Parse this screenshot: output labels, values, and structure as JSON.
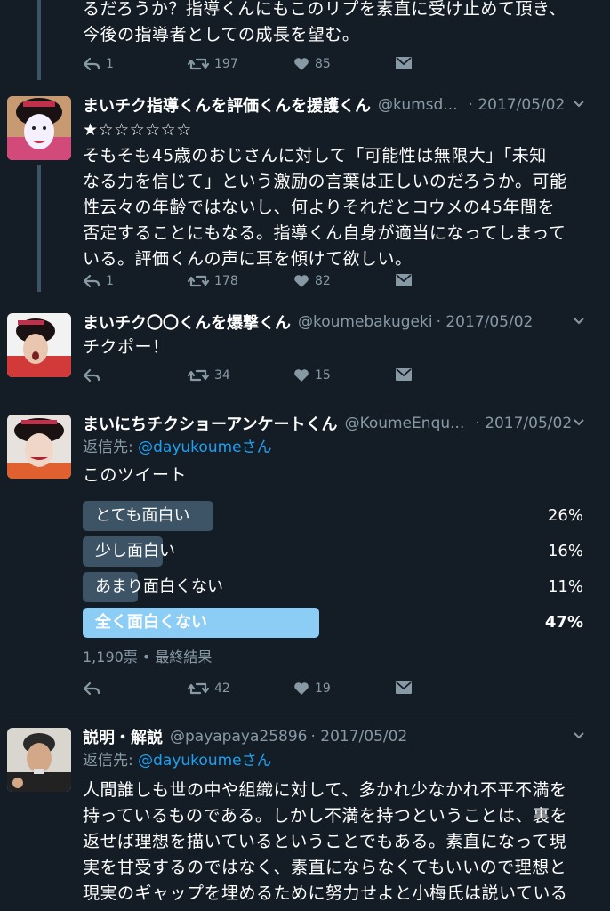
{
  "tweets": [
    {
      "text_lines": [
        "るだろうか？指導くんにもこのリプを素直に受け止めて頂き、",
        "今後の指導者としての成長を望む。"
      ],
      "replies": "1",
      "retweets": "197",
      "likes": "85"
    },
    {
      "name": "まいチク指導くんを評価くんを援護くん",
      "handle": "@kumsd...",
      "date": "· 2017/05/02",
      "stars": "★☆☆☆☆☆☆",
      "text_lines": [
        "そもそも45歳のおじさんに対して「可能性は無限大」「未知",
        "なる力を信じて」という激励の言葉は正しいのだろうか。可能",
        "性云々の年齢ではないし、何よりそれだとコウメの45年間を",
        "否定することにもなる。指導くん自身が適当になってしまって",
        "いる。評価くんの声に耳を傾けて欲しい。"
      ],
      "replies": "1",
      "retweets": "178",
      "likes": "82"
    },
    {
      "name": "まいチク〇〇くんを爆撃くん",
      "handle": "@koumebakugeki",
      "date": "· 2017/05/02",
      "text_lines": [
        "チクポー！"
      ],
      "replies": "",
      "retweets": "34",
      "likes": "15"
    },
    {
      "name": "まいにちチクショーアンケートくん",
      "handle": "@KoumeEnqu...",
      "date": "· 2017/05/02",
      "reply_prefix": "返信先: ",
      "reply_target": "@dayukoumeさん",
      "text_lines": [
        "このツイート"
      ],
      "poll": {
        "options": [
          {
            "label": "とても面白い",
            "percent": "26%",
            "value": 26
          },
          {
            "label": "少し面白い",
            "percent": "16%",
            "value": 16
          },
          {
            "label": "あまり面白くない",
            "percent": "11%",
            "value": 11
          },
          {
            "label": "全く面白くない",
            "percent": "47%",
            "value": 47
          }
        ],
        "meta": "1,190票 • 最終結果"
      },
      "replies": "",
      "retweets": "42",
      "likes": "19"
    },
    {
      "name": "説明・解説",
      "handle": "@payapaya25896",
      "date": "· 2017/05/02",
      "reply_prefix": "返信先: ",
      "reply_target": "@dayukoumeさん",
      "text_lines": [
        "人間誰しも世の中や組織に対して、多かれ少なかれ不平不満を",
        "持っているものである。しかし不満を持つということは、裏を",
        "返せば理想を描いているということでもある。素直になって現",
        "実を甘受するのではなく、素直にならなくてもいいので理想と",
        "現実のギャップを埋めるために努力せよと小梅氏は説いている"
      ]
    }
  ],
  "colors": {
    "background": "#141d26",
    "muted": "#8899a6",
    "link": "#1da1f2",
    "poll_bar": "#3d5466",
    "poll_winner": "#8ccdf5"
  }
}
